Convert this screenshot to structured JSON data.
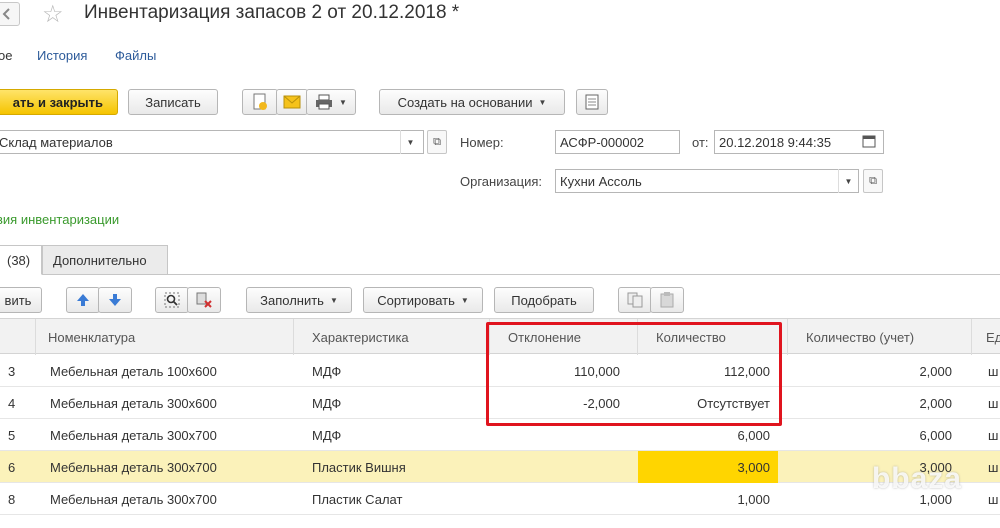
{
  "window": {
    "title": "Инвентаризация запасов 2 от 20.12.2018 *"
  },
  "links": {
    "main": "ое",
    "history": "История",
    "files": "Файлы"
  },
  "toolbar": {
    "post_close": "ать и закрыть",
    "save": "Записать",
    "create_based": "Создать на основании"
  },
  "form": {
    "warehouse": "Склад материалов",
    "number_label": "Номер:",
    "number": "АСФР-000002",
    "date_label": "от:",
    "date": "20.12.2018  9:44:35",
    "org_label": "Организация:",
    "org": "Кухни Ассоль",
    "results_link": "вия инвентаризации"
  },
  "tabs": [
    {
      "label": "(38)"
    },
    {
      "label": "Дополнительно"
    }
  ],
  "table_toolbar": {
    "add": "вить",
    "fill": "Заполнить",
    "sort": "Сортировать",
    "pick": "Подобрать"
  },
  "table": {
    "columns": [
      "Номенклатура",
      "Характеристика",
      "Отклонение",
      "Количество",
      "Количество (учет)",
      "Ед"
    ],
    "rows": [
      {
        "n": "3",
        "item": "Мебельная деталь 100х600",
        "char": "МДФ",
        "dev": "110,000",
        "qty": "112,000",
        "qty_acc": "2,000",
        "unit": "ш"
      },
      {
        "n": "4",
        "item": "Мебельная деталь 300х600",
        "char": "МДФ",
        "dev": "-2,000",
        "qty": "Отсутствует",
        "qty_acc": "2,000",
        "unit": "ш"
      },
      {
        "n": "5",
        "item": "Мебельная деталь 300х700",
        "char": "МДФ",
        "dev": "",
        "qty": "6,000",
        "qty_acc": "6,000",
        "unit": "ш"
      },
      {
        "n": "6",
        "item": "Мебельная деталь 300х700",
        "char": "Пластик Вишня",
        "dev": "",
        "qty": "3,000",
        "qty_acc": "3,000",
        "unit": "ш"
      },
      {
        "n": "8",
        "item": "Мебельная деталь 300х700",
        "char": "Пластик Салат",
        "dev": "",
        "qty": "1,000",
        "qty_acc": "1,000",
        "unit": "ш"
      }
    ]
  },
  "watermark": "bbaza",
  "colors": {
    "accent_yellow": "#f5c400",
    "selected_row": "#fbf2ba",
    "highlight_cell": "#ffd500",
    "annotation_red": "#e0141e",
    "link_blue": "#2d5b9a",
    "link_green": "#3a9a2d"
  },
  "icons": [
    "back-arrow-icon",
    "star-icon",
    "doc-icon",
    "envelope-icon",
    "printer-icon",
    "report-icon",
    "arrow-up-icon",
    "arrow-down-icon",
    "find-icon",
    "filter-icon",
    "copy-icon",
    "paste-icon",
    "calendar-icon",
    "open-icon"
  ]
}
